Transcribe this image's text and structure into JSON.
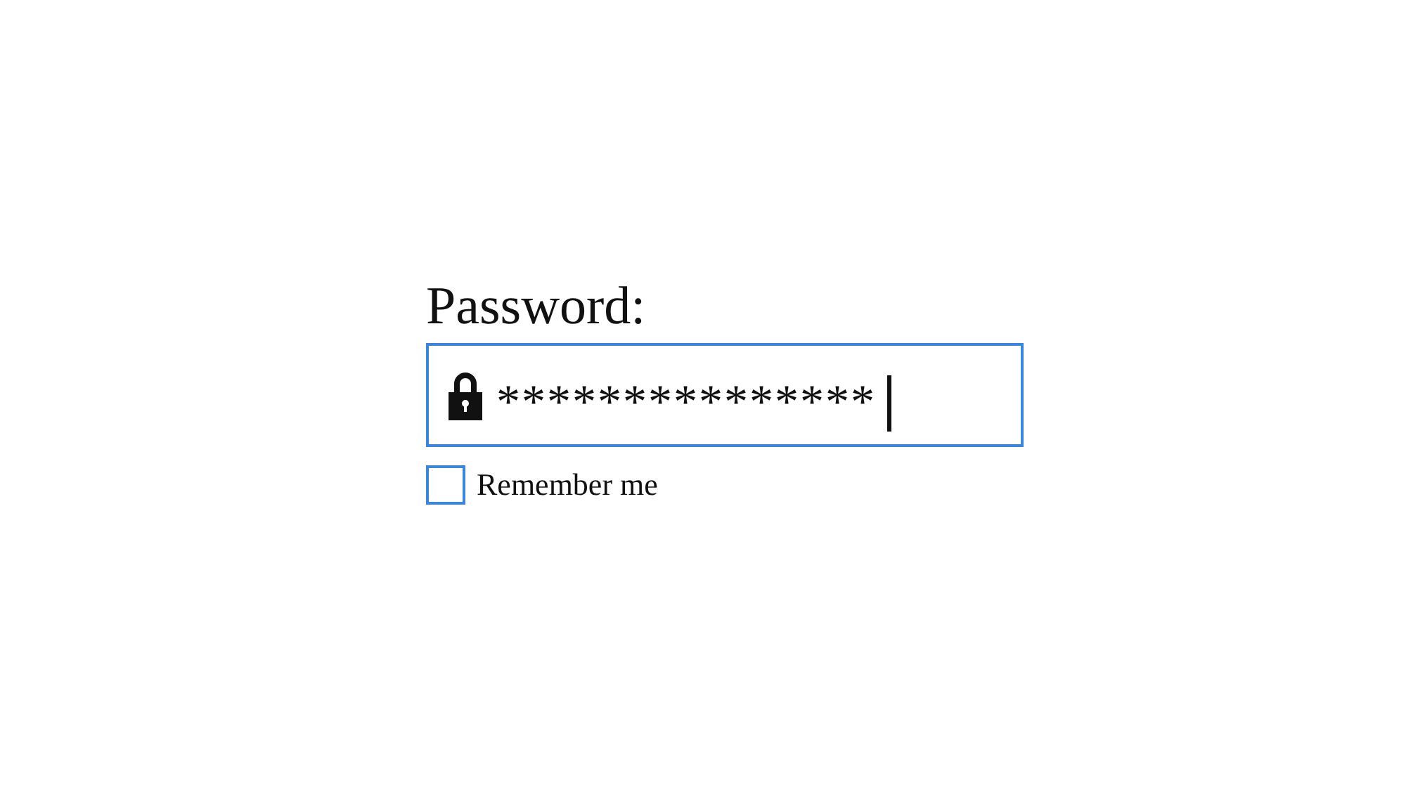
{
  "password": {
    "label": "Password:",
    "value": "***************",
    "focused": true
  },
  "remember": {
    "label": "Remember me",
    "checked": false
  }
}
